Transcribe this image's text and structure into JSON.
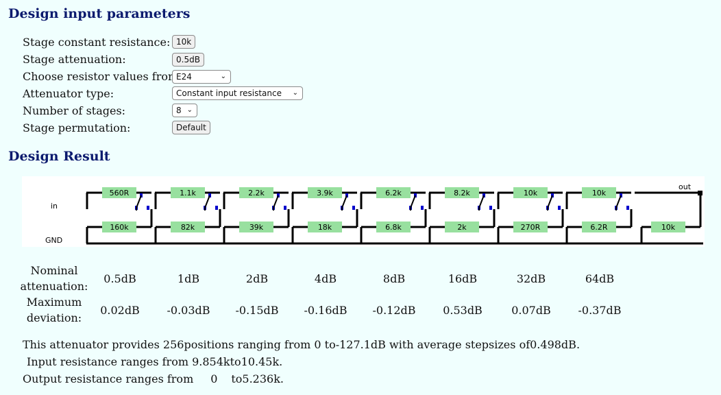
{
  "headings": {
    "params": "Design input parameters",
    "result": "Design Result"
  },
  "params": {
    "stage_resistance": {
      "label": "Stage constant resistance:",
      "value": "10k"
    },
    "stage_attenuation": {
      "label": "Stage attenuation:",
      "value": "0.5dB"
    },
    "resistor_series": {
      "label": "Choose resistor values from:",
      "value": "E24"
    },
    "attenuator_type": {
      "label": "Attenuator type:",
      "value": "Constant input resistance"
    },
    "num_stages": {
      "label": "Number of stages:",
      "value": "8"
    },
    "permutation": {
      "label": "Stage permutation:",
      "value": "Default"
    }
  },
  "schematic": {
    "in_label": "in",
    "gnd_label": "GND",
    "out_label": "out",
    "series_resistors": [
      "560R",
      "1.1k",
      "2.2k",
      "3.9k",
      "6.2k",
      "8.2k",
      "10k",
      "10k"
    ],
    "shunt_resistors": [
      "160k",
      "82k",
      "39k",
      "18k",
      "6.8k",
      "2k",
      "270R",
      "6.2R"
    ],
    "load_resistor": "10k",
    "colors": {
      "resistor_fill": "#98e09f",
      "wire": "#000000",
      "switch": "#0000cc"
    }
  },
  "table": {
    "nominal_label": "Nominal attenuation:",
    "deviation_label": "Maximum deviation:",
    "nominal": [
      "0.5dB",
      "1dB",
      "2dB",
      "4dB",
      "8dB",
      "16dB",
      "32dB",
      "64dB"
    ],
    "deviation": [
      "0.02dB",
      "-0.03dB",
      "-0.15dB",
      "-0.16dB",
      "-0.12dB",
      "0.53dB",
      "0.07dB",
      "-0.37dB"
    ]
  },
  "summary": {
    "l1_a": "This attenuator provides",
    "positions": "256",
    "l1_b": "positions ranging from 0 to",
    "range": "-127.1dB",
    "l1_c": "with average stepsizes of",
    "step": "0.498dB",
    "l1_d": ".",
    "l2_a": "Input resistance ranges from",
    "in_min": "9.854k",
    "l2_b": "to",
    "in_max": "10.45k",
    "l2_c": ".",
    "l3_a": "Output resistance ranges from",
    "out_min": "0",
    "l3_b": "to",
    "out_max": "5.236k",
    "l3_c": "."
  }
}
